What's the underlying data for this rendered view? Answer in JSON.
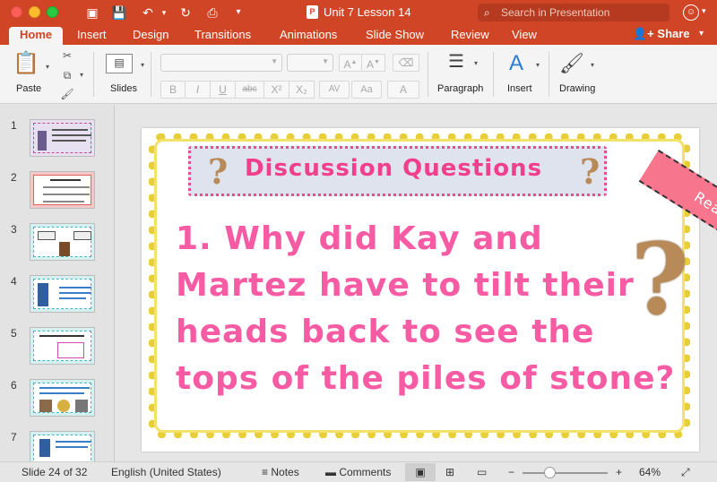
{
  "window": {
    "title": "Unit 7 Lesson 14",
    "search_placeholder": "Search in Presentation"
  },
  "tabs": [
    "Home",
    "Insert",
    "Design",
    "Transitions",
    "Animations",
    "Slide Show",
    "Review",
    "View"
  ],
  "share_label": "Share",
  "ribbon": {
    "paste": "Paste",
    "slides": "Slides",
    "paragraph": "Paragraph",
    "insert": "Insert",
    "drawing": "Drawing",
    "format_buttons": [
      "B",
      "I",
      "U",
      "abc",
      "X²",
      "X₂",
      "AV",
      "Aa",
      "A"
    ]
  },
  "thumbnails": [
    "1",
    "2",
    "3",
    "4",
    "5",
    "6",
    "7"
  ],
  "slide": {
    "title": "Discussion Questions",
    "question": "1. Why did Kay and Martez have to tilt their heads back to see the tops of the piles of stone?",
    "banner": "Reading Time"
  },
  "status": {
    "slide_info": "Slide 24 of 32",
    "language": "English (United States)",
    "notes": "Notes",
    "comments": "Comments",
    "zoom": "64%",
    "zoom_fraction": 0.64
  },
  "colors": {
    "accent": "#d04525",
    "title_pink": "#f03f8d",
    "question_pink": "#f65ba4",
    "glitter_gold": "#e8cf3a",
    "banner": "#f8768d"
  }
}
